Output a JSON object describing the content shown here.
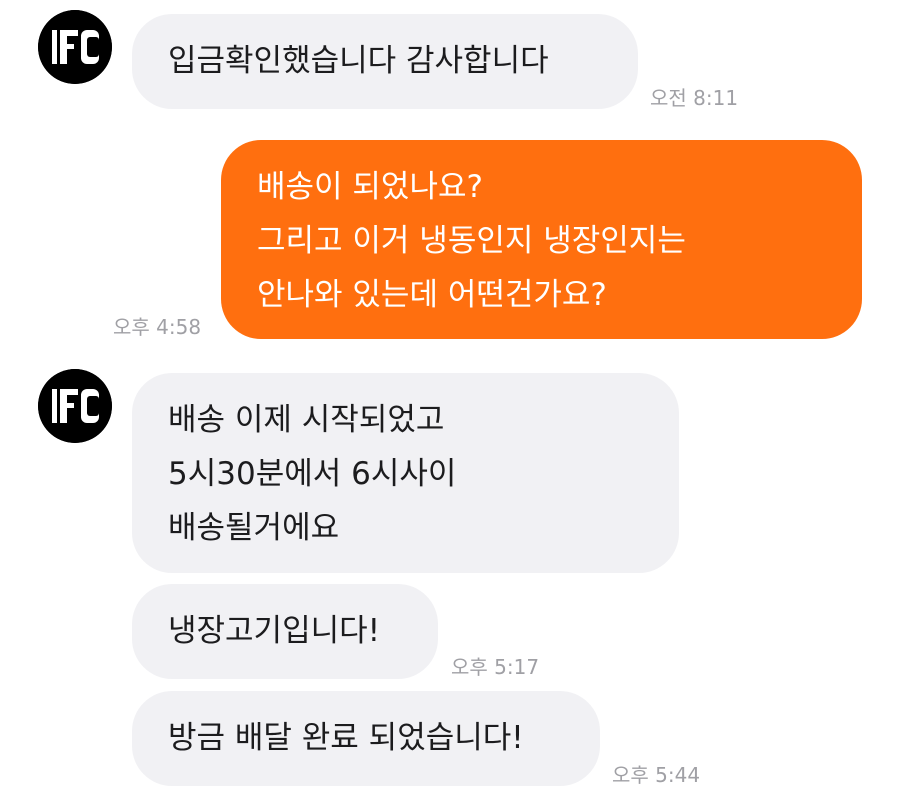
{
  "colors": {
    "incoming_bubble": "#f1f1f4",
    "outgoing_bubble": "#ff6f0f",
    "incoming_text": "#1c1c1e",
    "outgoing_text": "#ffffff",
    "timestamp": "#a0a0a5"
  },
  "avatar": {
    "icon": "seller-logo-icon"
  },
  "messages": [
    {
      "sender": "seller",
      "lines": [
        "입금확인했습니다 감사합니다"
      ],
      "time": "오전 8:11"
    },
    {
      "sender": "me",
      "lines": [
        "배송이 되었나요?",
        "그리고 이거 냉동인지 냉장인지는",
        "안나와 있는데 어떤건가요?"
      ],
      "time": "오후 4:58"
    },
    {
      "sender": "seller",
      "lines": [
        "배송 이제 시작되었고",
        "5시30분에서 6시사이",
        "배송될거에요"
      ],
      "time": ""
    },
    {
      "sender": "seller",
      "lines": [
        "냉장고기입니다!"
      ],
      "time": "오후 5:17"
    },
    {
      "sender": "seller",
      "lines": [
        "방금 배달 완료 되었습니다!"
      ],
      "time": "오후 5:44"
    }
  ]
}
